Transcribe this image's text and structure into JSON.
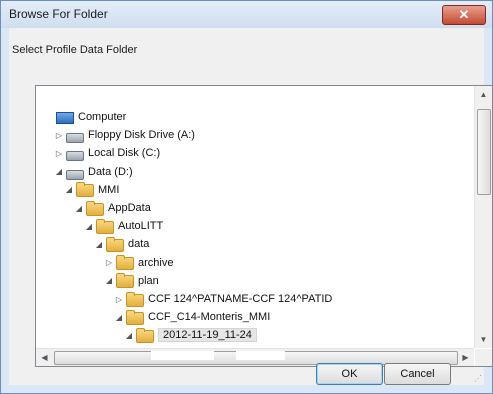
{
  "window": {
    "title": "Browse For Folder",
    "close_icon": "close-icon",
    "prompt": "Select Profile Data Folder"
  },
  "tree": {
    "items": [
      {
        "label": "Computer",
        "icon": "computer-icon",
        "arrow": "",
        "level": 0
      },
      {
        "label": "Floppy Disk Drive (A:)",
        "icon": "floppy-icon",
        "arrow": "▷",
        "level": 1
      },
      {
        "label": "Local Disk (C:)",
        "icon": "drive-icon",
        "arrow": "▷",
        "level": 1
      },
      {
        "label": "Data (D:)",
        "icon": "drive-icon",
        "arrow": "◢",
        "level": 1
      },
      {
        "label": "MMI",
        "icon": "folder-icon",
        "arrow": "◢",
        "level": 2
      },
      {
        "label": "AppData",
        "icon": "folder-icon",
        "arrow": "◢",
        "level": 3
      },
      {
        "label": "AutoLITT",
        "icon": "folder-icon",
        "arrow": "◢",
        "level": 4
      },
      {
        "label": "data",
        "icon": "folder-icon",
        "arrow": "◢",
        "level": 5
      },
      {
        "label": "archive",
        "icon": "folder-icon",
        "arrow": "▷",
        "level": 6
      },
      {
        "label": "plan",
        "icon": "folder-icon",
        "arrow": "◢",
        "level": 6
      },
      {
        "label": "CCF 124^PATNAME-CCF 124^PATID",
        "icon": "folder-icon",
        "arrow": "▷",
        "level": 7
      },
      {
        "label": "CCF_C14-Monteris_MMI",
        "icon": "folder-icon",
        "arrow": "◢",
        "level": 7
      },
      {
        "label": "2012-11-19_11-24",
        "icon": "folder-icon",
        "arrow": "◢",
        "level": 8,
        "selected": true
      }
    ]
  },
  "scrollbar": {
    "horizontal_thumb_glyph": "III"
  },
  "buttons": {
    "ok": "OK",
    "cancel": "Cancel"
  }
}
